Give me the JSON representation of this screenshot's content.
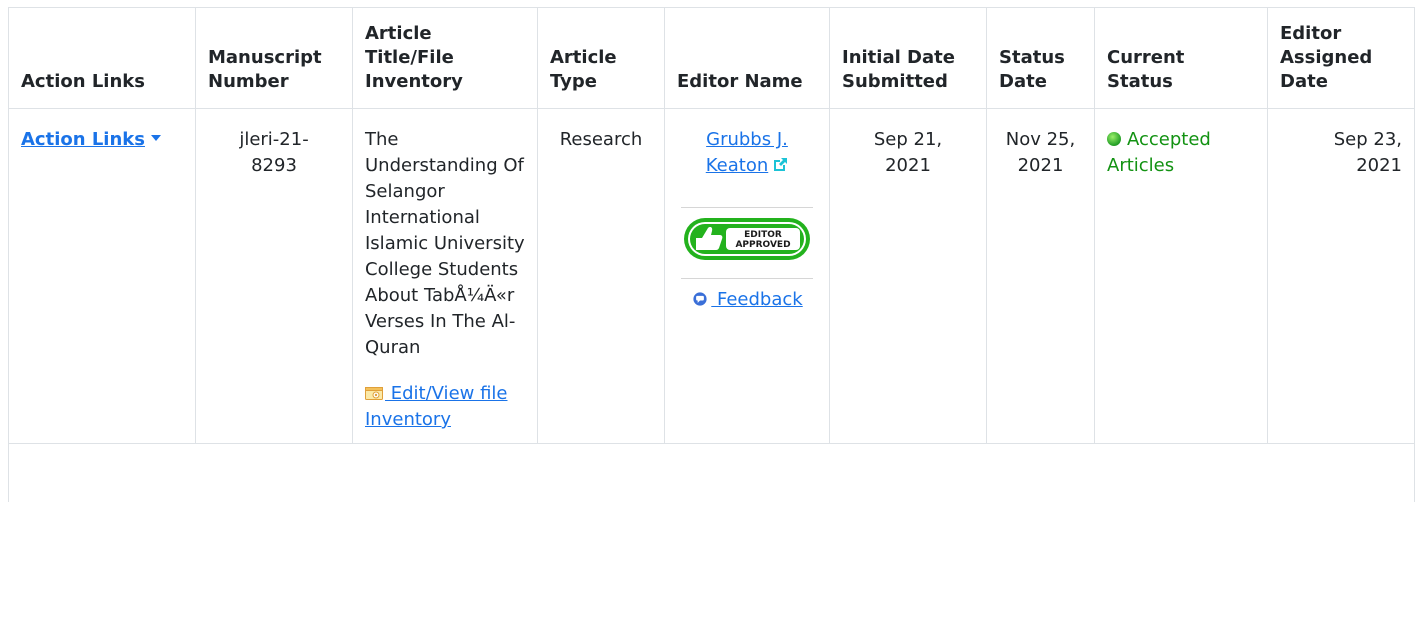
{
  "headers": {
    "action_links": "Action Links",
    "manuscript_number": "Manuscript Number",
    "article_title": "Article Title/File Inventory",
    "article_type": "Article Type",
    "editor_name": "Editor Name",
    "initial_date": "Initial Date Submitted",
    "status_date": "Status Date",
    "current_status": "Current Status",
    "editor_assigned": "Editor Assigned Date"
  },
  "row": {
    "action_link": "Action Links",
    "manuscript_number": "jleri-21-8293",
    "title": "The Understanding Of Selangor International Islamic University College Students About TabÅ¼Ä«r Verses In The Al-Quran",
    "file_inventory_link": " Edit/View file Inventory",
    "article_type": "Research",
    "editor_name": "Grubbs J. Keaton",
    "badge_line1": "EDITOR",
    "badge_line2": "APPROVED",
    "feedback_link": " Feedback",
    "initial_date": "Sep 21, 2021",
    "status_date": "Nov 25, 2021",
    "current_status": "Accepted Articles",
    "editor_assigned_date": "Sep 23, 2021"
  },
  "colors": {
    "link": "#1a73e8",
    "status_green": "#129212",
    "badge_green": "#23b21d",
    "external_icon": "#1cc3d6"
  },
  "icons": [
    "caret-down-icon",
    "external-link-icon",
    "thumbs-up-icon",
    "feedback-icon",
    "status-dot-icon",
    "file-inventory-icon"
  ]
}
